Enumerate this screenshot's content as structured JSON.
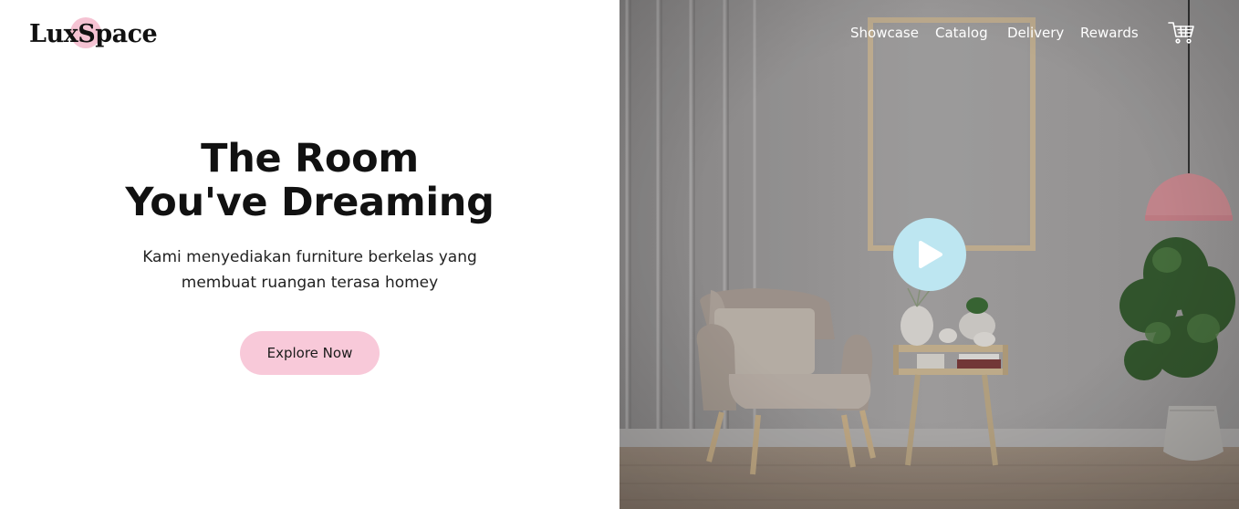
{
  "brand": {
    "name": "LuxSpace",
    "accent_color": "#f5c3d3"
  },
  "hero": {
    "title_line1": "The Room",
    "title_line2": "You've Dreaming",
    "subtitle_line1": "Kami menyediakan furniture berkelas yang",
    "subtitle_line2": "membuat ruangan terasa homey",
    "cta_label": "Explore Now",
    "cta_color": "#f8c9d9"
  },
  "nav": {
    "items": [
      {
        "label": "Showcase"
      },
      {
        "label": "Catalog"
      },
      {
        "label": "Delivery"
      },
      {
        "label": "Rewards"
      }
    ],
    "cart_icon": "cart-icon"
  },
  "media": {
    "play_icon": "play-icon",
    "play_color": "#bde6f1"
  }
}
